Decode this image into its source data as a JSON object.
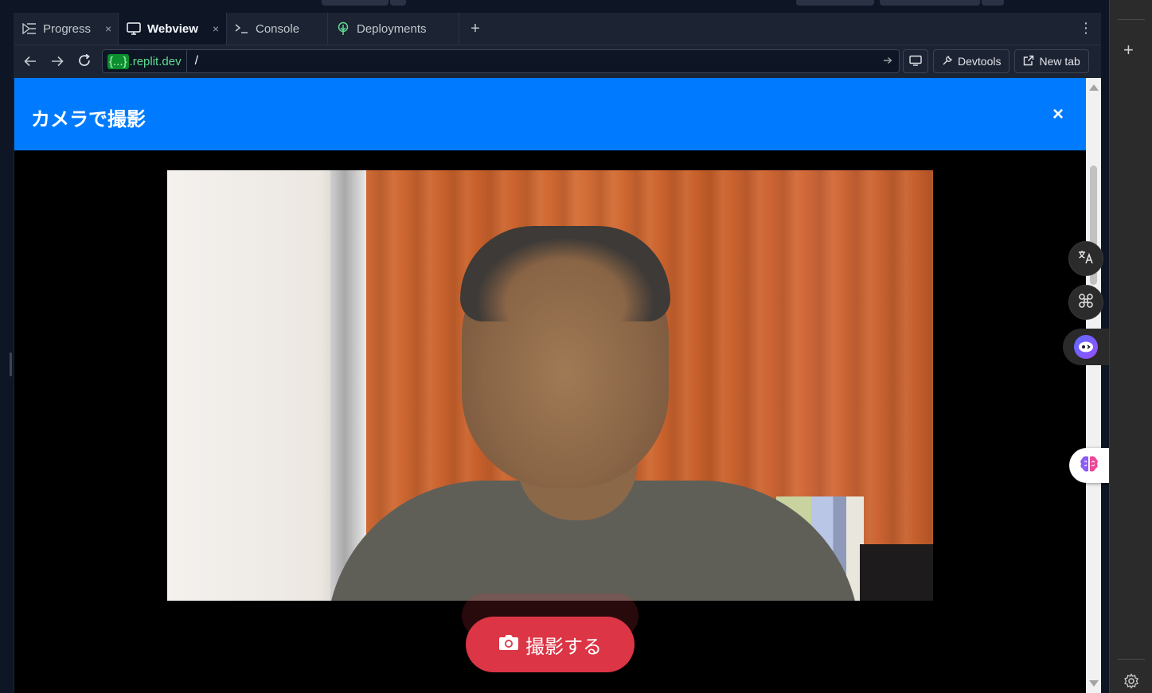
{
  "tabs": [
    {
      "label": "Progress",
      "icon": "progress-icon",
      "closable": true,
      "active": false
    },
    {
      "label": "Webview",
      "icon": "monitor-icon",
      "closable": true,
      "active": true
    },
    {
      "label": "Console",
      "icon": "terminal-icon",
      "closable": false,
      "active": false
    },
    {
      "label": "Deployments",
      "icon": "deployments-icon",
      "closable": false,
      "active": false
    }
  ],
  "tab_close_glyph": "×",
  "urlbar": {
    "domain_braces": "{...}",
    "domain_suffix": ".replit.dev",
    "path": "/",
    "devtools_label": "Devtools",
    "new_tab_label": "New tab"
  },
  "modal": {
    "title": "カメラで撮影",
    "close_glyph": "×",
    "capture_label": "撮影する"
  },
  "colors": {
    "header_blue": "#007bff",
    "capture_red": "#dc3545",
    "domain_green": "#5fdc91"
  }
}
